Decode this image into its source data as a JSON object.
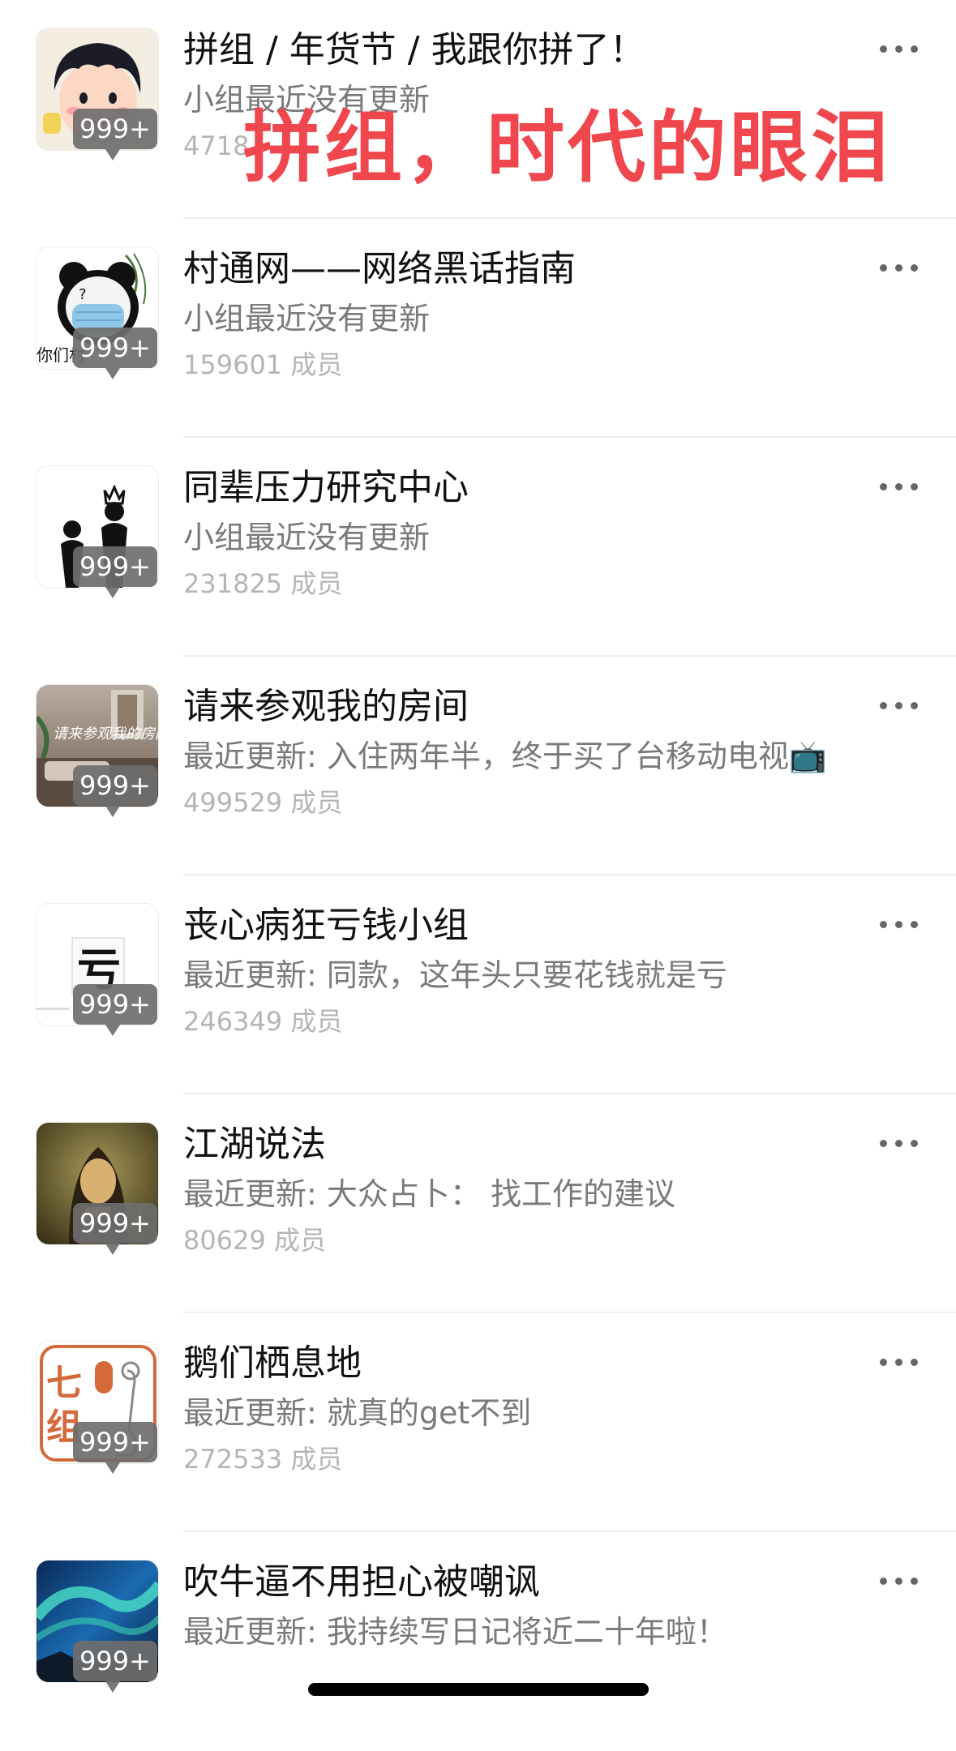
{
  "overlay_caption": "拼组，时代的眼泪",
  "groups": [
    {
      "title": "拼组 / 年货节 / 我跟你拼了！",
      "subtitle": "小组最近没有更新",
      "members": "4718",
      "badge": "999+",
      "avatar_icon": "cartoon-girl-avatar",
      "more_icon": "more-icon"
    },
    {
      "title": "村通网——网络黑话指南",
      "subtitle": "小组最近没有更新",
      "members": "159601 成员",
      "badge": "999+",
      "avatar_icon": "panda-meme-avatar",
      "avatar_text": "你们村",
      "more_icon": "more-icon"
    },
    {
      "title": "同辈压力研究中心",
      "subtitle": "小组最近没有更新",
      "members": "231825 成员",
      "badge": "999+",
      "avatar_icon": "stick-figures-crown-avatar",
      "more_icon": "more-icon"
    },
    {
      "title": "请来参观我的房间",
      "subtitle": "最近更新: 入住两年半，终于买了台移动电视📺",
      "members": "499529 成员",
      "badge": "999+",
      "avatar_icon": "room-photo-avatar",
      "avatar_text": "请来参观我的房间",
      "more_icon": "more-icon"
    },
    {
      "title": "丧心病狂亏钱小组",
      "subtitle": "最近更新: 同款，这年头只要花钱就是亏",
      "members": "246349 成员",
      "badge": "999+",
      "avatar_icon": "kui-character-avatar",
      "avatar_text": "亏",
      "more_icon": "more-icon"
    },
    {
      "title": "江湖说法",
      "subtitle": "最近更新: 大众占卜： 找工作的建议",
      "members": "80629 成员",
      "badge": "999+",
      "avatar_icon": "mona-lisa-avatar",
      "more_icon": "more-icon"
    },
    {
      "title": "鹅们栖息地",
      "subtitle": "最近更新: 就真的get不到",
      "members": "272533 成员",
      "badge": "999+",
      "avatar_icon": "goose-seal-avatar",
      "avatar_text": "七组",
      "more_icon": "more-icon"
    },
    {
      "title": "吹牛逼不用担心被嘲讽",
      "subtitle": "最近更新: 我持续写日记将近二十年啦！",
      "members": "",
      "badge": "999+",
      "avatar_icon": "aurora-avatar",
      "more_icon": "more-icon"
    }
  ],
  "colors": {
    "overlay_red": "#f0464e",
    "badge_gray": "#6e6e6e",
    "subtitle_gray": "#7a7a7a",
    "member_gray": "#b5b5b5"
  }
}
